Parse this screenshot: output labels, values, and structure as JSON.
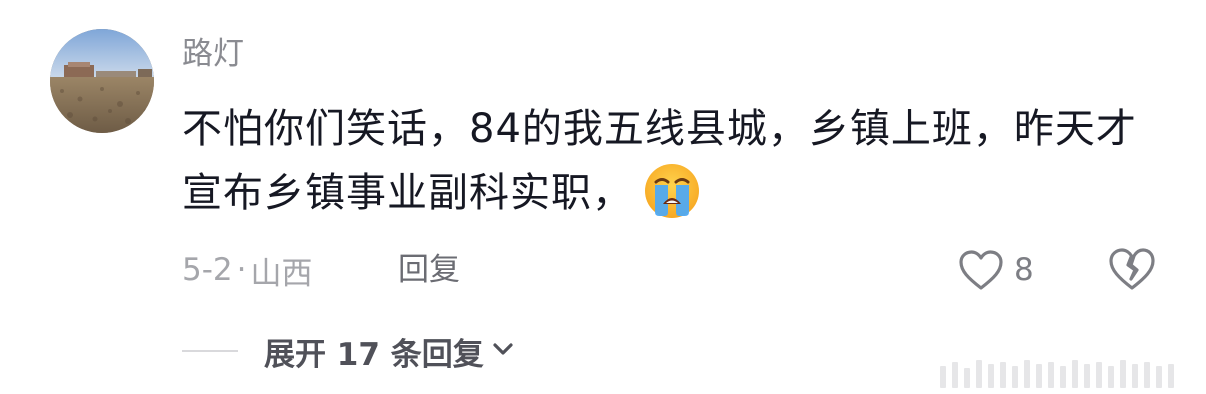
{
  "comment": {
    "username": "路灯",
    "text": "不怕你们笑话，84的我五线县城，乡镇上班，昨天才宣布乡镇事业副科实职，",
    "emoji": "loudly-crying-face-icon",
    "date": "5-2",
    "separator": "·",
    "location": "山西",
    "reply_label": "回复",
    "like_count": "8",
    "expand_label": "展开 17 条回复"
  },
  "colors": {
    "text": "#161823",
    "muted": "#a5a6ab",
    "username": "#8a8b91"
  }
}
